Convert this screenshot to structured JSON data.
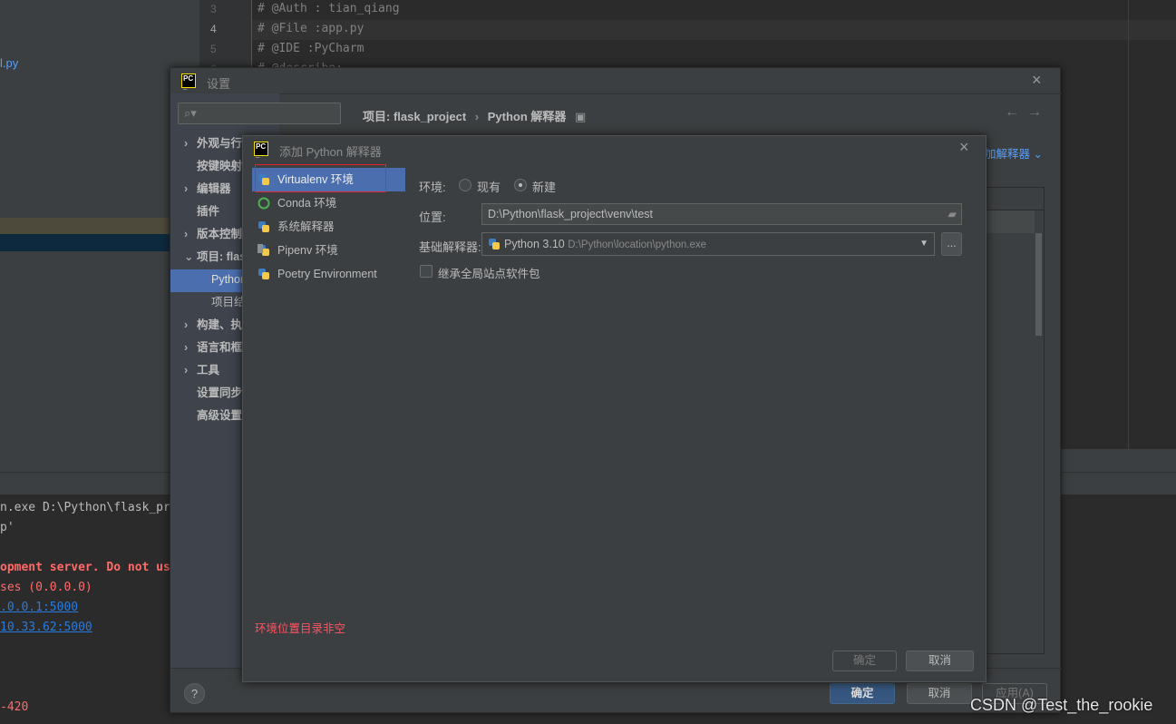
{
  "project_panel": {
    "file": "l.py"
  },
  "editor": {
    "lines": [
      {
        "num": "3",
        "text": "# @Auth : tian_qiang"
      },
      {
        "num": "4",
        "text": "# @File :app.py"
      },
      {
        "num": "5",
        "text": "# @IDE  :PyCharm"
      },
      {
        "num": "6",
        "text": "# @describe:"
      }
    ]
  },
  "terminal": {
    "lines": [
      "n.exe D:\\Python\\flask_pr",
      "p'",
      "",
      "opment server. Do not us",
      "ses (0.0.0.0)",
      ".0.0.1:5000",
      "10.33.62:5000",
      "",
      "",
      "-420"
    ]
  },
  "settings": {
    "title": "设置",
    "search_placeholder": "",
    "breadcrumb": {
      "project": "项目: flask_project",
      "page": "Python 解释器"
    },
    "add_interpreter_link": "加解释器",
    "sidebar": [
      {
        "label": "外观与行为",
        "chev": "›"
      },
      {
        "label": "按键映射",
        "chev": ""
      },
      {
        "label": "编辑器",
        "chev": "›"
      },
      {
        "label": "插件",
        "chev": ""
      },
      {
        "label": "版本控制",
        "chev": "›"
      },
      {
        "label": "项目: flask_project",
        "chev": "⌄"
      },
      {
        "label": "Python 解释器",
        "chev": "",
        "sub": true
      },
      {
        "label": "项目结构",
        "chev": "",
        "sub": true
      },
      {
        "label": "构建、执行、部署",
        "chev": "›"
      },
      {
        "label": "语言和框架",
        "chev": "›"
      },
      {
        "label": "工具",
        "chev": "›"
      },
      {
        "label": "设置同步",
        "chev": ""
      },
      {
        "label": "高级设置",
        "chev": ""
      }
    ],
    "ok": "确定",
    "cancel": "取消",
    "apply": "应用(A)",
    "help": "?"
  },
  "add_dialog": {
    "title": "添加 Python 解释器",
    "types": [
      "Virtualenv 环境",
      "Conda 环境",
      "系统解释器",
      "Pipenv 环境",
      "Poetry Environment"
    ],
    "selected_type": "Virtualenv 环境",
    "env_label": "环境:",
    "env_existing": "现有",
    "env_new": "新建",
    "env_selected": "新建",
    "location_label": "位置:",
    "location_value": "D:\\Python\\flask_project\\venv\\test",
    "base_label": "基础解释器:",
    "base_name": "Python 3.10",
    "base_path": "D:\\Python\\location\\python.exe",
    "browse": "...",
    "inherit_label": "继承全局站点软件包",
    "inherit_checked": false,
    "error": "环境位置目录非空",
    "ok": "确定",
    "cancel": "取消"
  },
  "watermark": "CSDN @Test_the_rookie",
  "colors": {
    "accent": "#4b6eaf",
    "error": "#ff5261",
    "link": "#589df6",
    "primary_button": "#365880",
    "highlight_box": "#e0262b"
  }
}
